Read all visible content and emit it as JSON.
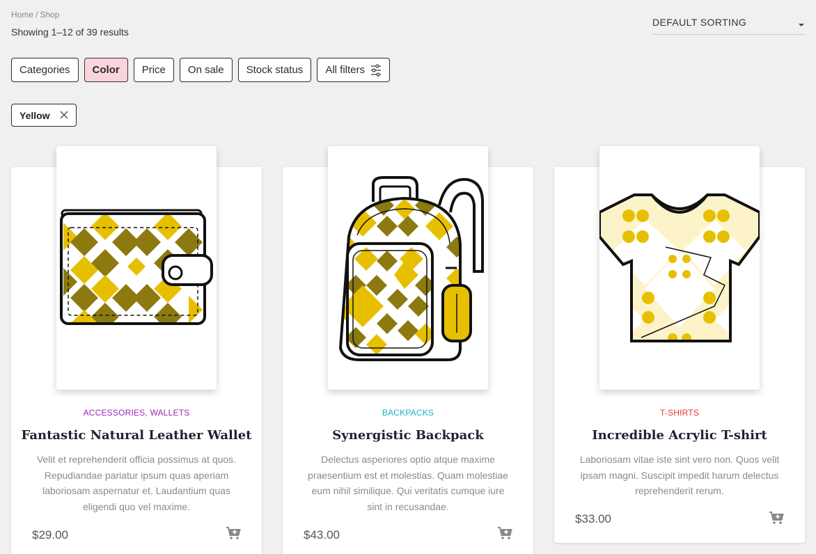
{
  "breadcrumb": {
    "home": "Home",
    "separator": "/",
    "current": "Shop"
  },
  "results_text": "Showing 1–12 of 39 results",
  "sorting": {
    "selected": "DEFAULT SORTING"
  },
  "filters": [
    {
      "label": "Categories",
      "active": false
    },
    {
      "label": "Color",
      "active": true
    },
    {
      "label": "Price",
      "active": false
    },
    {
      "label": "On sale",
      "active": false
    },
    {
      "label": "Stock status",
      "active": false
    },
    {
      "label": "All filters",
      "active": false,
      "icon": "sliders-icon"
    }
  ],
  "active_chip": {
    "label": "Yellow",
    "icon": "close-icon"
  },
  "products": [
    {
      "category": "ACCESSORIES, WALLETS",
      "category_color": "#9c27b0",
      "name": "Fantastic Natural Leather Wallet",
      "description": "Velit et reprehenderit officia possimus at quos. Repudiandae pariatur ipsum quas aperiam laboriosam aspernatur et. Laudantium quas eligendi quo vel maxime.",
      "price": "$29.00",
      "image": "wallet-image",
      "cart_icon": "add-to-cart-icon"
    },
    {
      "category": "BACKPACKS",
      "category_color": "#17b3c1",
      "name": "Synergistic Backpack",
      "description": "Delectus asperiores optio atque maxime praesentium est et molestias. Quam molestiae eum nihil similique. Qui veritatis cumque iure sint in recusandae.",
      "price": "$43.00",
      "image": "backpack-image",
      "cart_icon": "add-to-cart-icon"
    },
    {
      "category": "T-SHIRTS",
      "category_color": "#e53935",
      "name": "Incredible Acrylic T-shirt",
      "description": "Laboriosam vitae iste sint vero non. Quos velit ipsam magni. Suscipit impedit harum delectus reprehenderit rerum.",
      "price": "$33.00",
      "image": "tshirt-image",
      "cart_icon": "add-to-cart-icon"
    }
  ],
  "colors": {
    "yellow": "#e6c000",
    "olive": "#8c7a10",
    "light_yellow": "#fdf3c8",
    "active_filter_bg": "#fbd3dd"
  }
}
